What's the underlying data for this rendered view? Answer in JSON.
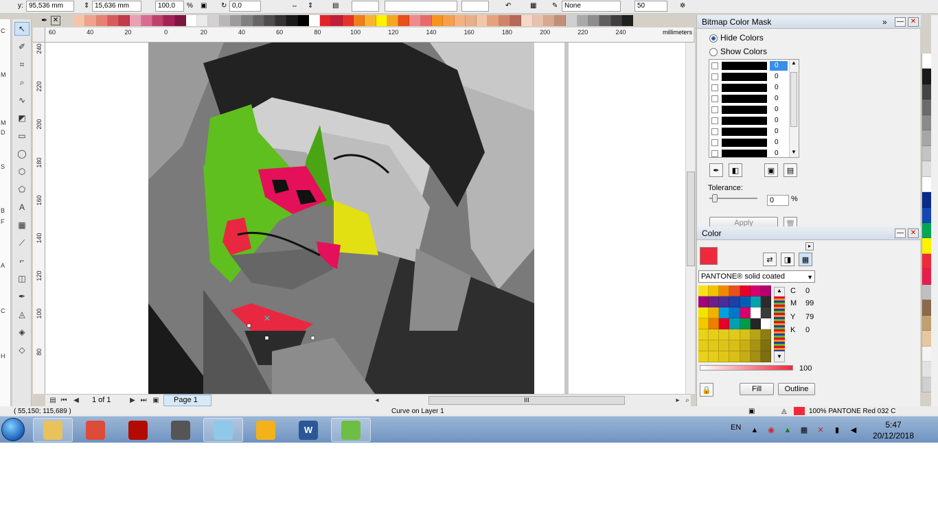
{
  "propbar": {
    "y_label": "y:",
    "y_value": "95,536 mm",
    "h_value": "15,636 mm",
    "scale_value": "100,0",
    "scale_unit": "%",
    "angle_value": "0,0",
    "outline_value": "None",
    "extra_value": "50"
  },
  "palette_top": [
    "#f6c3a6",
    "#f2a18c",
    "#e88074",
    "#d65a5e",
    "#c23a4c",
    "#e9a0b4",
    "#d86c90",
    "#c0406c",
    "#a32256",
    "#7f1640",
    "#ffffff",
    "#eaeaea",
    "#d2d2d2",
    "#b8b8b8",
    "#9c9c9c",
    "#808080",
    "#666666",
    "#4d4d4d",
    "#333333",
    "#1a1a1a",
    "#000000",
    "#ffffff",
    "#e2232a",
    "#c01f3b",
    "#e6332a",
    "#ef7f1a",
    "#f9b233",
    "#fff200",
    "#f5a623",
    "#e94e1b",
    "#f08a8a",
    "#e86a6a",
    "#f7941d",
    "#f6a04d",
    "#f4b183",
    "#e8b088",
    "#f2c6a6",
    "#e6a27e",
    "#d1846a",
    "#b86856",
    "#f7d8c6",
    "#e9c2ae",
    "#d7a892",
    "#c28e76",
    "#d0d0d0",
    "#a9a9a9",
    "#8d8d8d",
    "#5f5f5f",
    "#3f3f3f",
    "#202020"
  ],
  "rulers": {
    "unit": "millimeters",
    "h_ticks": [
      "60",
      "40",
      "20",
      "0",
      "20",
      "40",
      "60",
      "80",
      "100",
      "120",
      "140",
      "160",
      "180",
      "200",
      "220",
      "240"
    ],
    "v_ticks": [
      "240",
      "220",
      "200",
      "180",
      "160",
      "140",
      "120",
      "100",
      "80"
    ]
  },
  "pagenav": {
    "page_count": "1 of 1",
    "page_tab": "Page 1",
    "hscroll_grip": "III"
  },
  "status": {
    "coords": "( 55,150; 115,689 )",
    "object": "Curve on Layer 1",
    "fill_info": "100% PANTONE Red 032 C"
  },
  "mask_docker": {
    "title": "Bitmap Color Mask",
    "hide_colors": "Hide Colors",
    "show_colors": "Show Colors",
    "rows": [
      "0",
      "0",
      "0",
      "0",
      "0",
      "0",
      "0",
      "0",
      "0"
    ],
    "tolerance_label": "Tolerance:",
    "tolerance_value": "0",
    "tolerance_unit": "%",
    "apply_label": "Apply"
  },
  "color_docker": {
    "title": "Color",
    "current_color": "#ee2a3c",
    "palette_name": "PANTONE® solid coated",
    "cmyk": {
      "c": "0",
      "m": "99",
      "y": "79",
      "k": "0"
    },
    "cmyk_labels": {
      "c": "C",
      "m": "M",
      "y": "Y",
      "k": "K"
    },
    "tint_value": "100",
    "fill_label": "Fill",
    "outline_label": "Outline",
    "swatches": [
      "#f7e11a",
      "#f2c200",
      "#ef8a00",
      "#e8501c",
      "#e4002b",
      "#d6006f",
      "#b5006f",
      "#a3007d",
      "#6a1f8f",
      "#4a2c9b",
      "#1e3ea8",
      "#005eb8",
      "#00a3ad",
      "#2b2b2b",
      "#f6e200",
      "#f0b400",
      "#00a0e0",
      "#0077c8",
      "#d8006a",
      "#ffffff",
      "#3b3b3b",
      "#f2c800",
      "#ef7d00",
      "#e4002b",
      "#00a0b0",
      "#009b48",
      "#262626",
      "#ffffff",
      "#e8d21a",
      "#e6cf1a",
      "#e4cc1a",
      "#e2ca1a",
      "#d8c018",
      "#b7a415",
      "#8c7e12",
      "#e6cc18",
      "#e3c818",
      "#dfc418",
      "#d9be18",
      "#c9af16",
      "#a99314",
      "#7f7110",
      "#e8d21a",
      "#e5ce1a",
      "#e0c818",
      "#d8c018",
      "#c6ac16",
      "#a38f14",
      "#7d6e10"
    ]
  },
  "right_palette": [
    "#ffffff",
    "#1a1a1a",
    "#444444",
    "#6b6b6b",
    "#8a8a8a",
    "#a6a6a6",
    "#c3c3c3",
    "#dedede",
    "#ffffff",
    "#0b2b8a",
    "#1347b5",
    "#00a651",
    "#fff200",
    "#ee2a3c",
    "#e61e50",
    "#c0c0c0",
    "#8a6a4a",
    "#bfa070",
    "#e6c8a0",
    "#f4f4f4",
    "#e2e2e2",
    "#d0d0d0"
  ],
  "taskbar": {
    "apps": [
      {
        "name": "explorer",
        "label": "",
        "color": "#e8c25a"
      },
      {
        "name": "chrome",
        "label": "",
        "color": "#dd4b39"
      },
      {
        "name": "acrobat",
        "label": "",
        "color": "#b30b00"
      },
      {
        "name": "calculator",
        "label": "",
        "color": "#555555"
      },
      {
        "name": "notes",
        "label": "",
        "color": "#8fc8e8"
      },
      {
        "name": "winamp",
        "label": "",
        "color": "#f3b21a"
      },
      {
        "name": "word",
        "label": "W",
        "color": "#2b5797"
      },
      {
        "name": "coreldraw",
        "label": "",
        "color": "#6fbe44"
      }
    ],
    "lang": "EN",
    "time": "5:47",
    "date": "20/12/2018"
  }
}
